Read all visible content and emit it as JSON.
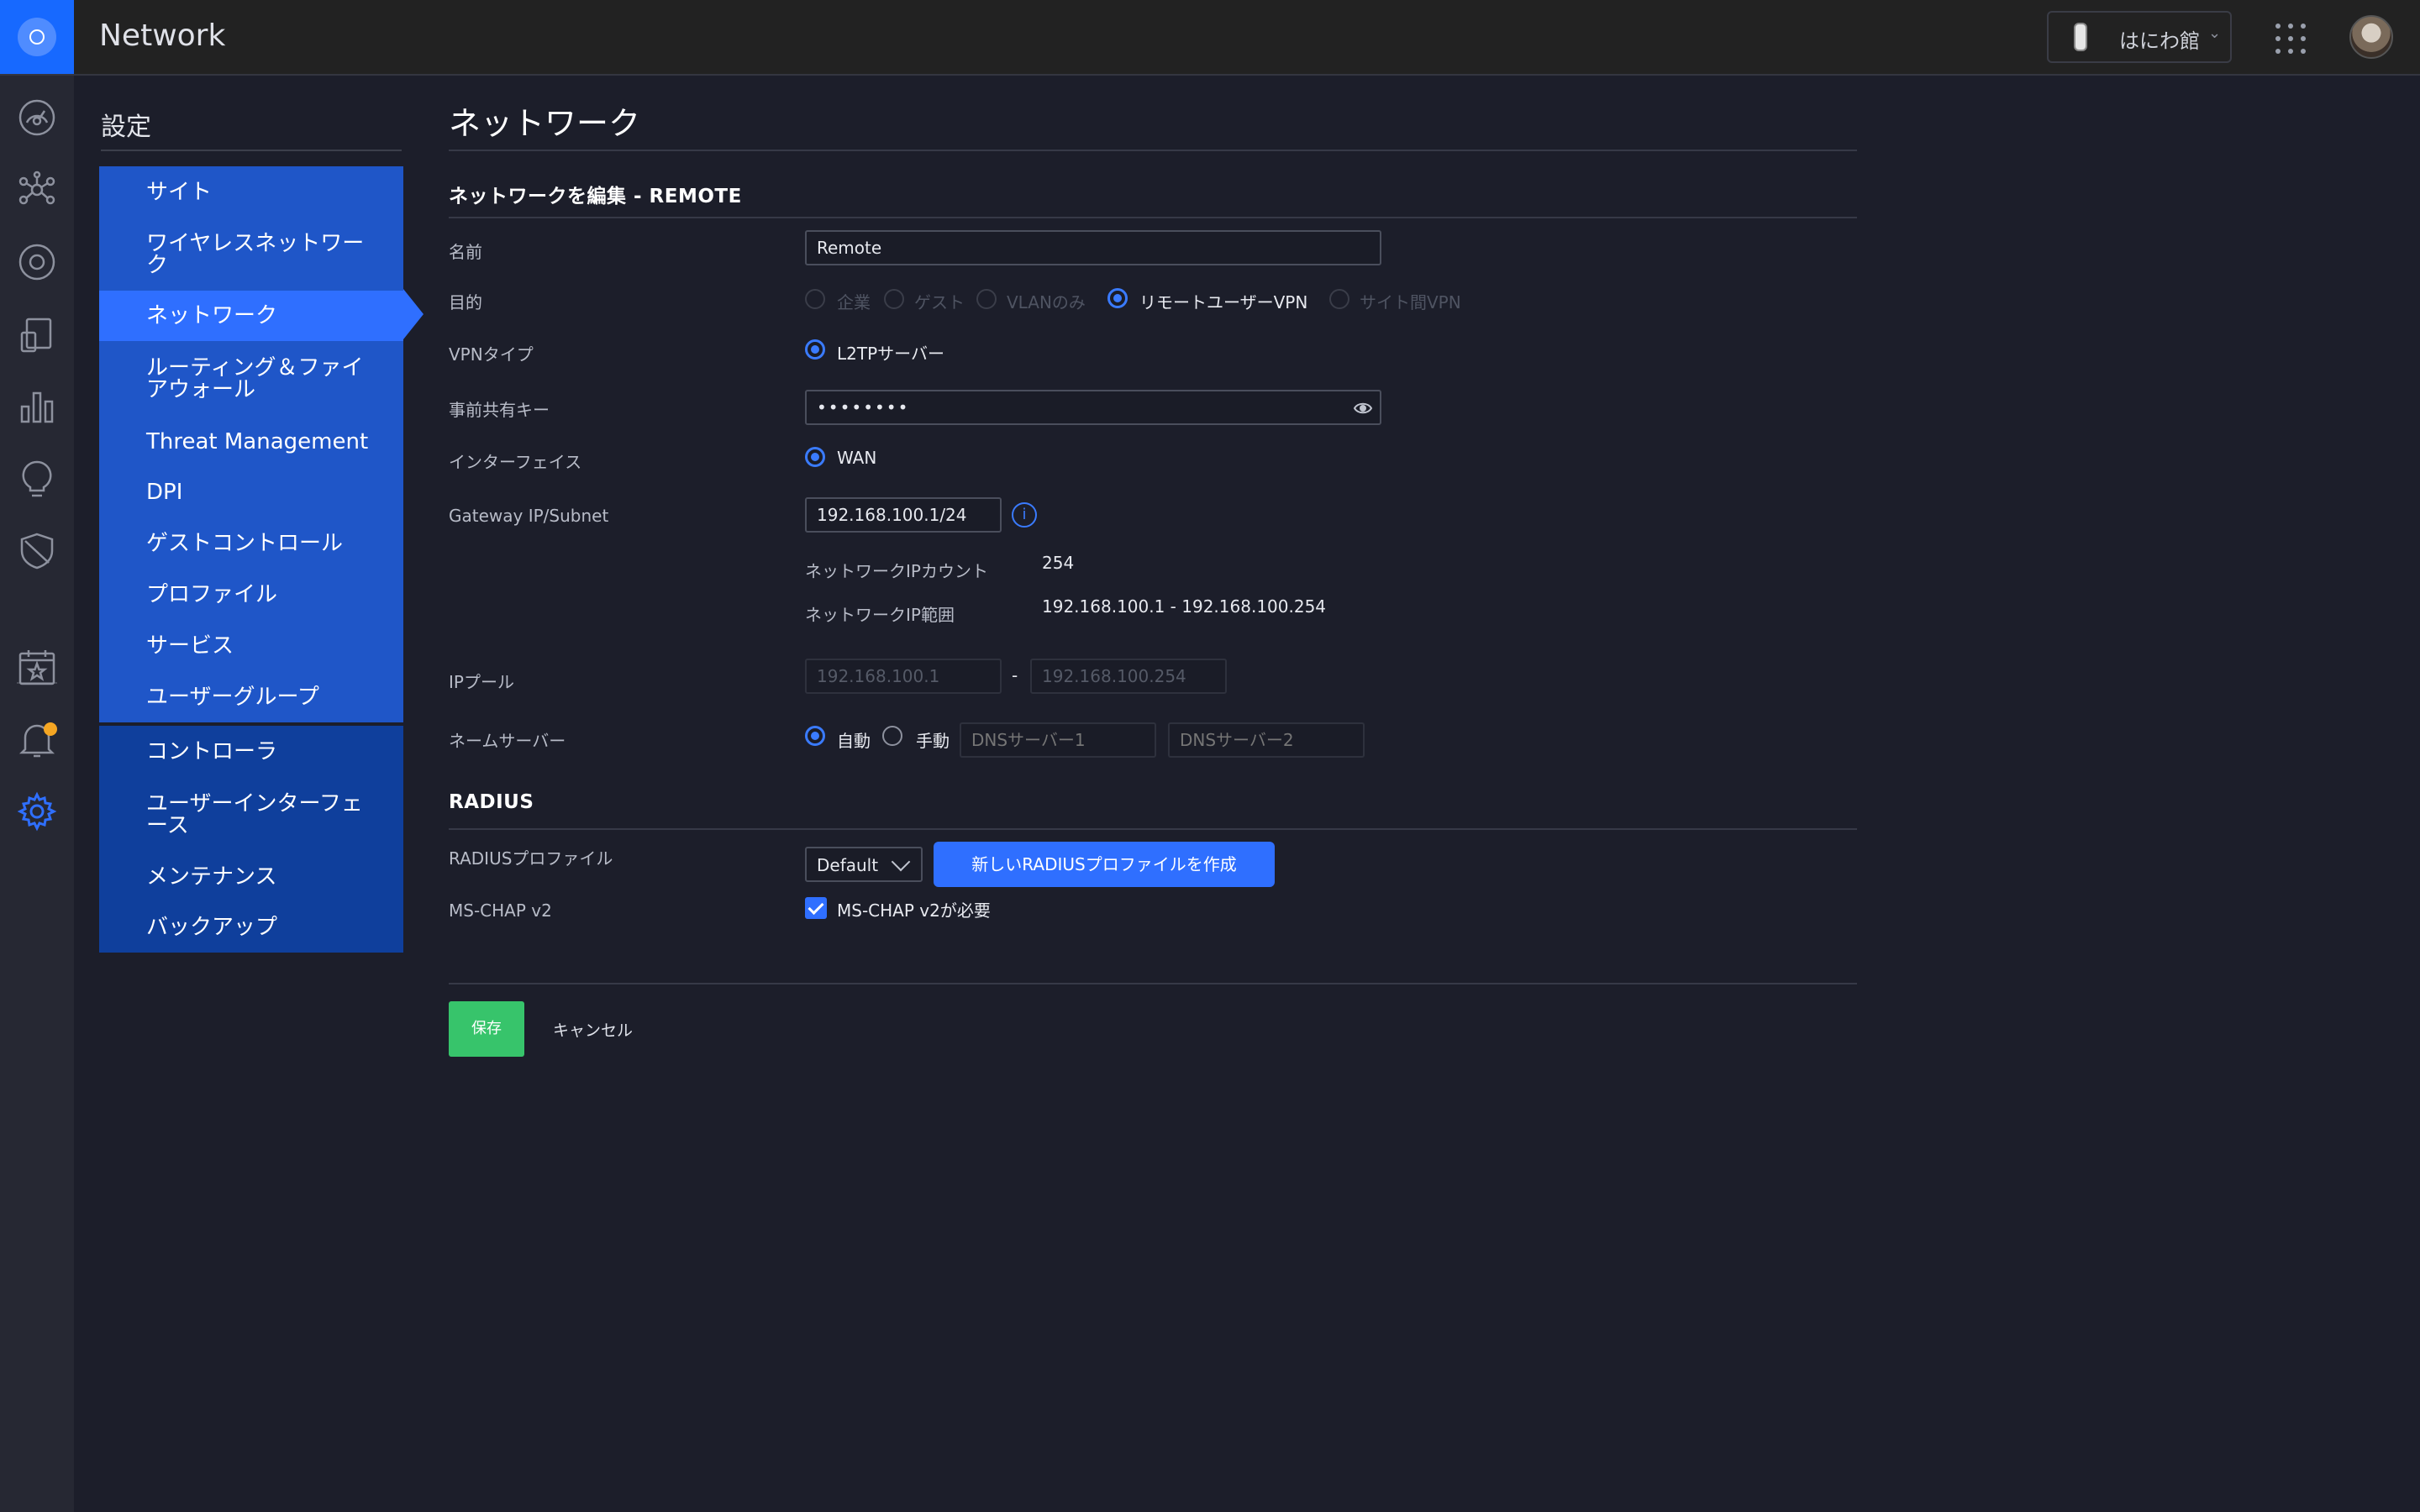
{
  "app": {
    "title": "Network"
  },
  "header": {
    "site_name": "はにわ館",
    "chevron": "⌄"
  },
  "settings": {
    "heading": "設定",
    "nav_group1": [
      "サイト",
      "ワイヤレスネットワーク",
      "ネットワーク",
      "ルーティング＆ファイアウォール",
      "Threat Management",
      "DPI",
      "ゲストコントロール",
      "プロファイル",
      "サービス",
      "ユーザーグループ"
    ],
    "nav_group2": [
      "コントローラ",
      "ユーザーインターフェース",
      "メンテナンス",
      "バックアップ"
    ],
    "active_item": "ネットワーク"
  },
  "page": {
    "title": "ネットワーク",
    "section_title": "ネットワークを編集 - REMOTE",
    "fields": {
      "name_label": "名前",
      "name_value": "Remote",
      "purpose_label": "目的",
      "purpose_options": [
        "企業",
        "ゲスト",
        "VLANのみ",
        "リモートユーザーVPN",
        "サイト間VPN"
      ],
      "purpose_selected": "リモートユーザーVPN",
      "vpn_type_label": "VPNタイプ",
      "vpn_type_value": "L2TPサーバー",
      "psk_label": "事前共有キー",
      "psk_value": "••••••••",
      "interface_label": "インターフェイス",
      "interface_value": "WAN",
      "gateway_label": "Gateway IP/Subnet",
      "gateway_value": "192.168.100.1/24",
      "info_glyph": "i",
      "ip_count_label": "ネットワークIPカウント",
      "ip_count_value": "254",
      "ip_range_label": "ネットワークIP範囲",
      "ip_range_value": "192.168.100.1 - 192.168.100.254",
      "ip_pool_label": "IPプール",
      "ip_pool_start": "192.168.100.1",
      "ip_pool_sep": "-",
      "ip_pool_end": "192.168.100.254",
      "nameserver_label": "ネームサーバー",
      "nameserver_auto": "自動",
      "nameserver_manual": "手動",
      "dns1_placeholder": "DNSサーバー1",
      "dns2_placeholder": "DNSサーバー2"
    },
    "radius": {
      "section_title": "RADIUS",
      "profile_label": "RADIUSプロファイル",
      "profile_value": "Default",
      "create_button": "新しいRADIUSプロファイルを作成",
      "mschap_label": "MS-CHAP v2",
      "mschap_checkbox_label": "MS-CHAP v2が必要",
      "mschap_checked": true
    },
    "actions": {
      "save": "保存",
      "cancel": "キャンセル"
    }
  },
  "colors": {
    "accent": "#2f6fff",
    "save": "#37c46b",
    "background": "#1c1e2a",
    "notification": "#f5a623"
  },
  "icons": [
    "dashboard-icon",
    "topology-icon",
    "devices-icon",
    "clients-icon",
    "statistics-icon",
    "insights-icon",
    "shield-icon",
    "events-icon",
    "alerts-icon",
    "settings-icon"
  ]
}
